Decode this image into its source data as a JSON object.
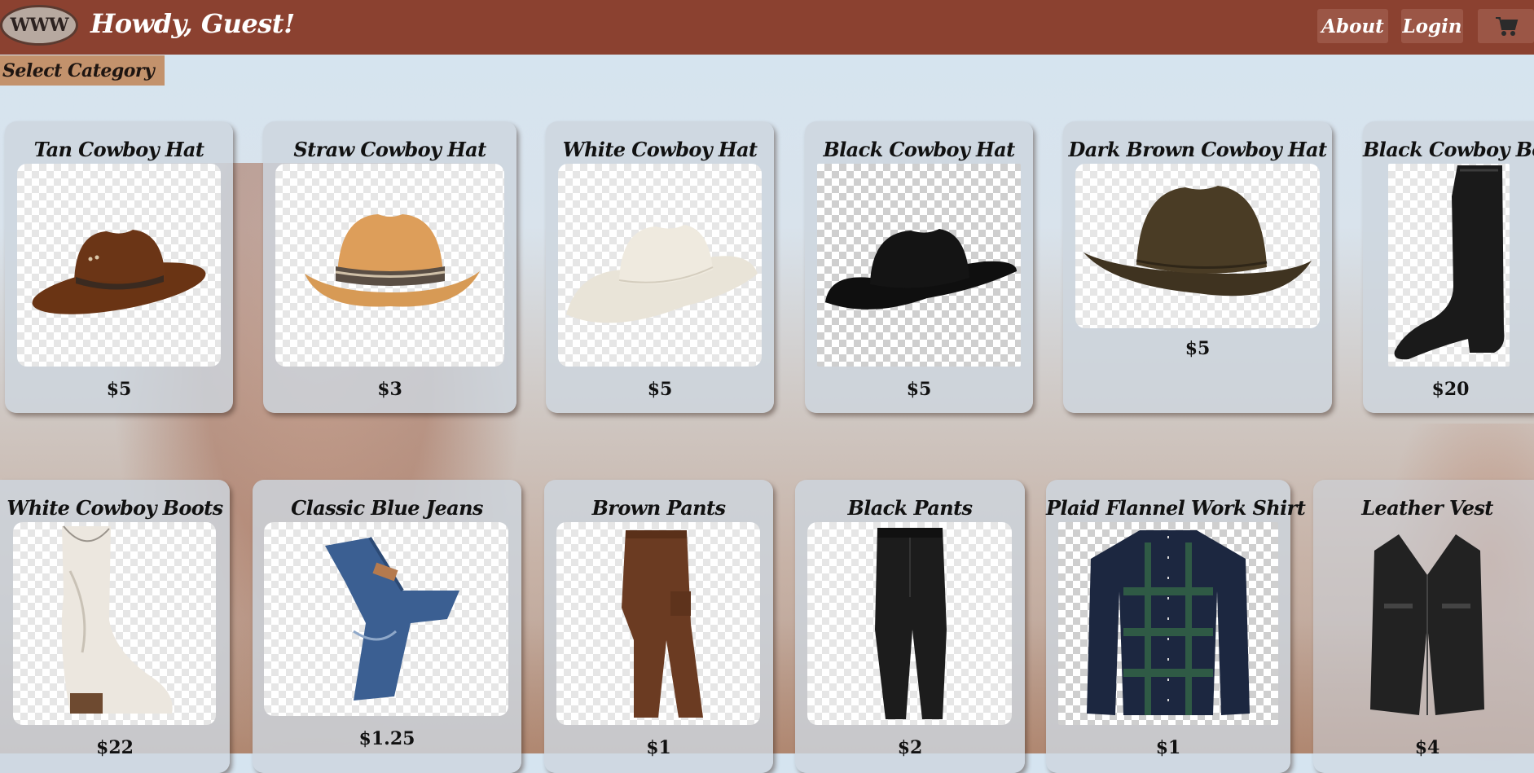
{
  "header": {
    "logo_text": "WWW",
    "greeting": "Howdy, Guest!",
    "about_label": "About",
    "login_label": "Login",
    "cart_icon": "cart-icon",
    "brand_color": "#8b4130"
  },
  "category": {
    "label": "Select Category"
  },
  "products": [
    {
      "title": "Tan Cowboy Hat",
      "price": "$5"
    },
    {
      "title": "Straw Cowboy Hat",
      "price": "$3"
    },
    {
      "title": "White Cowboy Hat",
      "price": "$5"
    },
    {
      "title": "Black Cowboy Hat",
      "price": "$5"
    },
    {
      "title": "Dark Brown Cowboy Hat",
      "price": "$5"
    },
    {
      "title": "Black Cowboy Boots",
      "price": "$20"
    },
    {
      "title": "White Cowboy Boots",
      "price": "$22"
    },
    {
      "title": "Classic Blue Jeans",
      "price": "$1.25"
    },
    {
      "title": "Brown Pants",
      "price": "$1"
    },
    {
      "title": "Black Pants",
      "price": "$2"
    },
    {
      "title": "Plaid Flannel Work Shirt",
      "price": "$1"
    },
    {
      "title": "Leather Vest",
      "price": "$4"
    }
  ]
}
